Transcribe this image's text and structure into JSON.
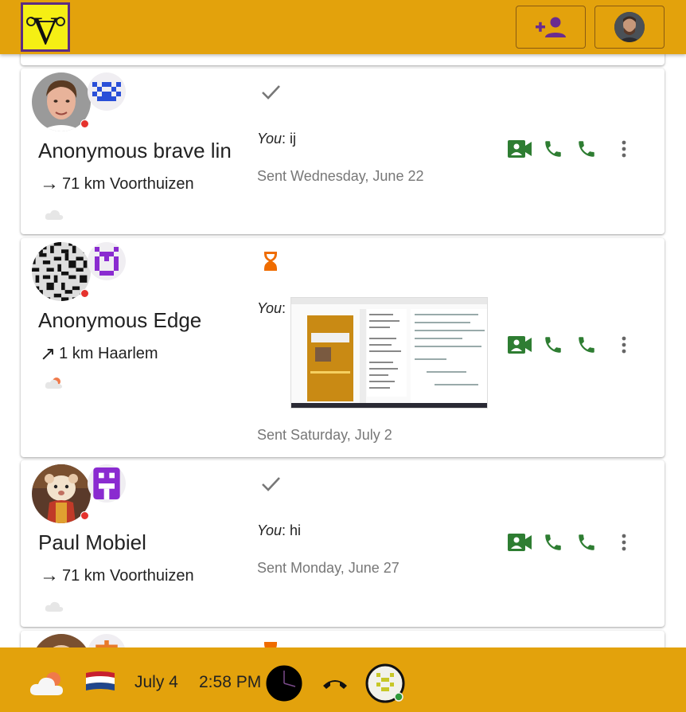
{
  "header": {
    "logo_letter": "V",
    "add_contact_icon": "person-add-icon",
    "profile_icon": "avatar"
  },
  "contacts": [
    {
      "name": "Anonymous brave lin",
      "distance_arrow": "→",
      "distance": "71 km Voorthuizen",
      "message_status_icon": "check-icon",
      "message_prefix": "You",
      "message_text": ": ij",
      "sent": "Sent Wednesday, June 22"
    },
    {
      "name": "Anonymous Edge",
      "distance_arrow": "↗",
      "distance": "1 km Haarlem",
      "message_status_icon": "hourglass-icon",
      "message_prefix": "You",
      "message_text": ":",
      "sent": "Sent Saturday, July 2"
    },
    {
      "name": "Paul Mobiel",
      "distance_arrow": "→",
      "distance": "71 km Voorthuizen",
      "message_status_icon": "check-icon",
      "message_prefix": "You",
      "message_text": ": hi",
      "sent": "Sent Monday, June 27"
    }
  ],
  "footer": {
    "weather_icon": "cloudy-icon",
    "flag_icon": "netherlands-flag-icon",
    "date": "July 4",
    "time": "2:58 PM",
    "clock_icon": "clock-icon",
    "hangup_icon": "hangup-icon",
    "self_identicon": "identicon"
  },
  "colors": {
    "accent": "#e3a20c",
    "action_green": "#2e7d32",
    "status_red": "#e5322d",
    "pending_orange": "#ef6c00",
    "logo_yellow": "#f5ef14",
    "logo_border": "#5b2c82"
  }
}
